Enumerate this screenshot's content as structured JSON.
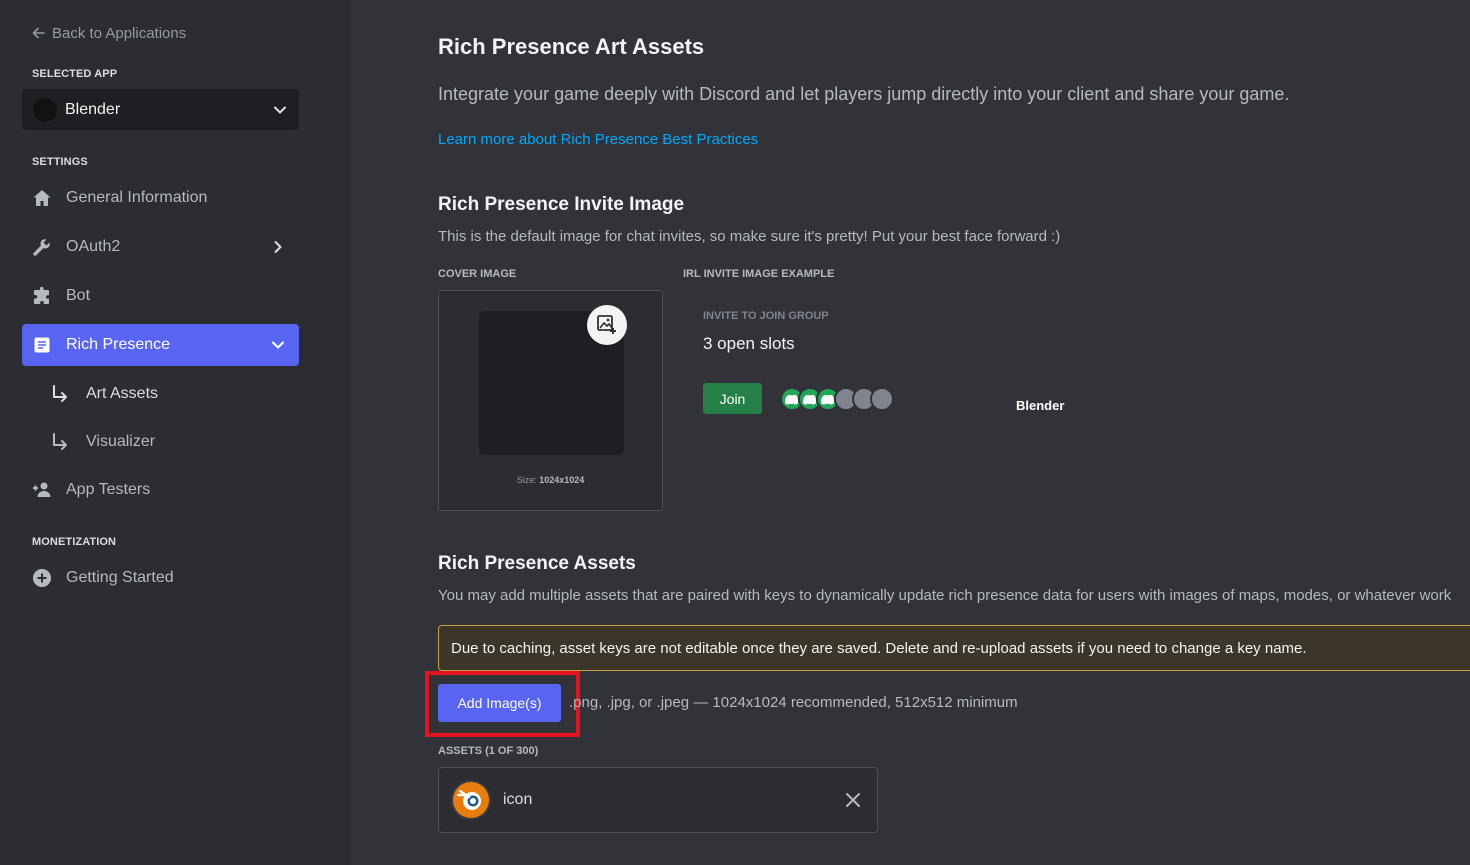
{
  "sidebar": {
    "back_label": "Back to Applications",
    "selected_app_heading": "SELECTED APP",
    "selected_app": "Blender",
    "settings_heading": "SETTINGS",
    "items": [
      {
        "label": "General Information"
      },
      {
        "label": "OAuth2"
      },
      {
        "label": "Bot"
      },
      {
        "label": "Rich Presence"
      },
      {
        "label": "App Testers"
      }
    ],
    "sub_items": [
      {
        "label": "Art Assets"
      },
      {
        "label": "Visualizer"
      }
    ],
    "monetization_heading": "MONETIZATION",
    "monetization_items": [
      {
        "label": "Getting Started"
      }
    ],
    "active_color": "#5865f2"
  },
  "main": {
    "title": "Rich Presence Art Assets",
    "intro": "Integrate your game deeply with Discord and let players jump directly into your client and share your game.",
    "learn_more": "Learn more about Rich Presence Best Practices",
    "invite_section": {
      "title": "Rich Presence Invite Image",
      "description": "This is the default image for chat invites, so make sure it's pretty! Put your best face forward :)",
      "cover_label": "COVER IMAGE",
      "example_label": "IRL INVITE IMAGE EXAMPLE",
      "size_prefix": "Size:",
      "size_value": "1024x1024",
      "invite_title": "INVITE TO JOIN GROUP",
      "slots": "3 open slots",
      "join_label": "Join",
      "game_name": "Blender"
    },
    "assets_section": {
      "title": "Rich Presence Assets",
      "description": "You may add multiple assets that are paired with keys to dynamically update rich presence data for users with images of maps, modes, or whatever work",
      "warning": "Due to caching, asset keys are not editable once they are saved. Delete and re-upload assets if you need to change a key name.",
      "add_button": "Add Image(s)",
      "formats": ".png, .jpg, or .jpeg — 1024x1024 recommended, 512x512 minimum",
      "assets_label": "ASSETS (1 OF 300)",
      "assets": [
        {
          "key": "icon",
          "icon": "blender-logo-icon"
        }
      ]
    }
  },
  "colors": {
    "background": "#313338",
    "sidebar": "#2b2d31",
    "brand": "#5865f2",
    "join_green": "#248046",
    "link": "#00a8fc",
    "warning_border": "#c69e3a",
    "highlight_red": "#e3141f"
  }
}
